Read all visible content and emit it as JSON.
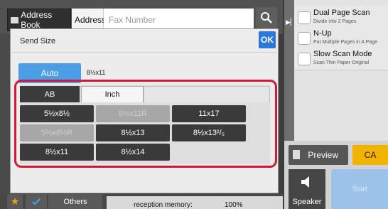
{
  "topbar": {
    "address_book_label": "Address Book",
    "address_label": "Address",
    "fax_placeholder": "Fax Number"
  },
  "dialog": {
    "title": "Send Size",
    "ok_label": "OK",
    "auto_label": "Auto",
    "auto_value": "8½x11",
    "tabs": [
      {
        "label": "AB",
        "selected": false
      },
      {
        "label": "Inch",
        "selected": true
      }
    ],
    "sizes": [
      {
        "label": "5½x8½",
        "enabled": true
      },
      {
        "label": "8½x11R",
        "enabled": false
      },
      {
        "label": "11x17",
        "enabled": true
      },
      {
        "label": "5½x8½R",
        "enabled": false
      },
      {
        "label": "8½x13",
        "enabled": true
      },
      {
        "label": "8½x13²/₅",
        "enabled": true
      },
      {
        "label": "8½x11",
        "enabled": true
      },
      {
        "label": "8½x14",
        "enabled": true
      }
    ],
    "highlight_color": "#d31a35"
  },
  "options": [
    {
      "title": "Dual Page Scan",
      "desc": "Divide into 2 Pages"
    },
    {
      "title": "N-Up",
      "desc": "Put Multiple Pages in A Page"
    },
    {
      "title": "Slow Scan Mode",
      "desc": "Scan Thin Paper Original"
    }
  ],
  "actions": {
    "preview_label": "Preview",
    "ca_label": "CA",
    "speaker_label": "Speaker",
    "start_label": "Start",
    "ca_color": "#f2b300",
    "start_color": "#9bc3ea"
  },
  "bottom": {
    "others_label": "Others",
    "memory_label": "reception memory:",
    "memory_value": "100%"
  },
  "icons": {
    "search": "search-icon",
    "star": "star-icon",
    "check": "check-icon",
    "speaker": "speaker-icon",
    "play": "play-arrow-icon",
    "address_book": "book-icon",
    "preview": "preview-icon"
  }
}
